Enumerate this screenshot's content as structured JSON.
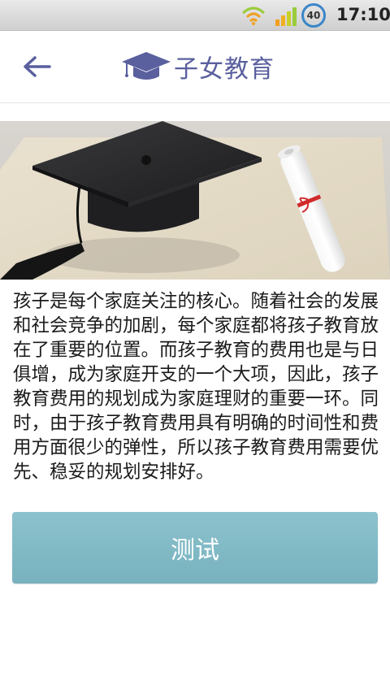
{
  "status_bar": {
    "battery_level": "40",
    "time": "17:10",
    "icons": [
      "wifi-icon",
      "signal-icon",
      "battery-icon"
    ]
  },
  "header": {
    "back_icon": "arrow-left-icon",
    "logo_icon": "graduation-cap-icon",
    "title": "子女教育",
    "brand_color": "#5a5f9e"
  },
  "hero": {
    "image": "graduation-cap-and-diploma-photo"
  },
  "body_text": "孩子是每个家庭关注的核心。随着社会的发展和社会竞争的加剧，每个家庭都将孩子教育放在了重要的位置。而孩子教育的费用也是与日俱增，成为家庭开支的一个大项，因此，孩子教育费用的规划成为家庭理财的重要一环。同时，由于孩子教育费用具有明确的时间性和费用方面很少的弹性，所以孩子教育费用需要优先、稳妥的规划安排好。",
  "test_button": {
    "label": "测试",
    "color": "#80bac6"
  }
}
